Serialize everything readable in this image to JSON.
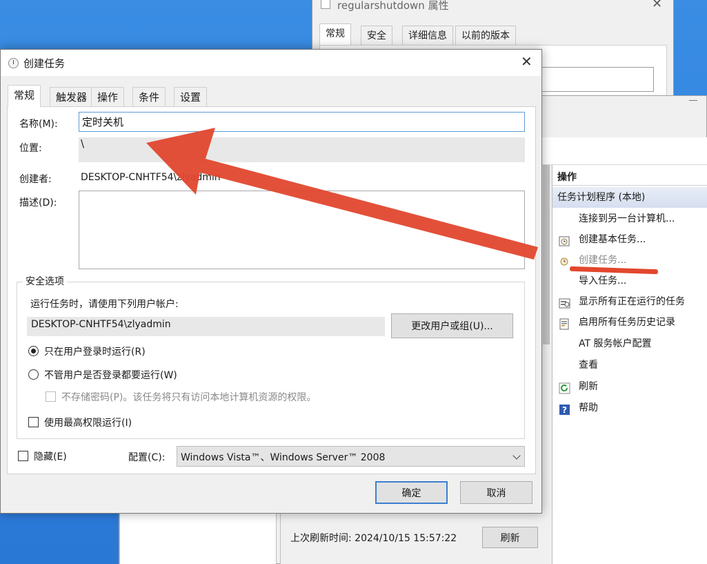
{
  "props_window": {
    "title": "regularshutdown 属性",
    "tabs": [
      "常规",
      "安全",
      "详细信息",
      "以前的版本"
    ]
  },
  "scheduler": {
    "refresh_label": "上次刷新时间: 2024/10/15 15:57:22",
    "refresh_button": "刷新",
    "actions_header": "操作",
    "actions_group": "任务计划程序 (本地)",
    "actions": [
      {
        "label": "连接到另一台计算机...",
        "icon": "none",
        "disabled": false
      },
      {
        "label": "创建基本任务...",
        "icon": "basic-task-icon",
        "disabled": false
      },
      {
        "label": "创建任务...",
        "icon": "create-task-icon",
        "disabled": true
      },
      {
        "label": "导入任务...",
        "icon": "none",
        "disabled": false
      },
      {
        "label": "显示所有正在运行的任务",
        "icon": "running-tasks-icon",
        "disabled": false
      },
      {
        "label": "启用所有任务历史记录",
        "icon": "history-icon",
        "disabled": false
      },
      {
        "label": "AT 服务帐户配置",
        "icon": "none",
        "disabled": false
      },
      {
        "label": "查看",
        "icon": "none",
        "disabled": false
      },
      {
        "label": "刷新",
        "icon": "refresh-icon",
        "disabled": false
      },
      {
        "label": "帮助",
        "icon": "help-icon",
        "disabled": false
      }
    ]
  },
  "dialog": {
    "title": "创建任务",
    "tabs": [
      "常规",
      "触发器",
      "操作",
      "条件",
      "设置"
    ],
    "name_label": "名称(M):",
    "name_value": "定时关机",
    "location_label": "位置:",
    "location_value": "\\",
    "author_label": "创建者:",
    "author_value": "DESKTOP-CNHTF54\\zlyadmin",
    "description_label": "描述(D):",
    "security_legend": "安全选项",
    "runas_label": "运行任务时，请使用下列用户帐户:",
    "runas_user": "DESKTOP-CNHTF54\\zlyadmin",
    "change_user_button": "更改用户或组(U)...",
    "opt_logged_on": "只在用户登录时运行(R)",
    "opt_whether_logged": "不管用户是否登录都要运行(W)",
    "opt_no_store_password": "不存储密码(P)。该任务将只有访问本地计算机资源的权限。",
    "opt_highest": "使用最高权限运行(I)",
    "hidden_label": "隐藏(E)",
    "config_label": "配置(C):",
    "config_value": "Windows Vista™、Windows Server™ 2008",
    "ok_button": "确定",
    "cancel_button": "取消"
  },
  "annotation_color": "#e2472e"
}
